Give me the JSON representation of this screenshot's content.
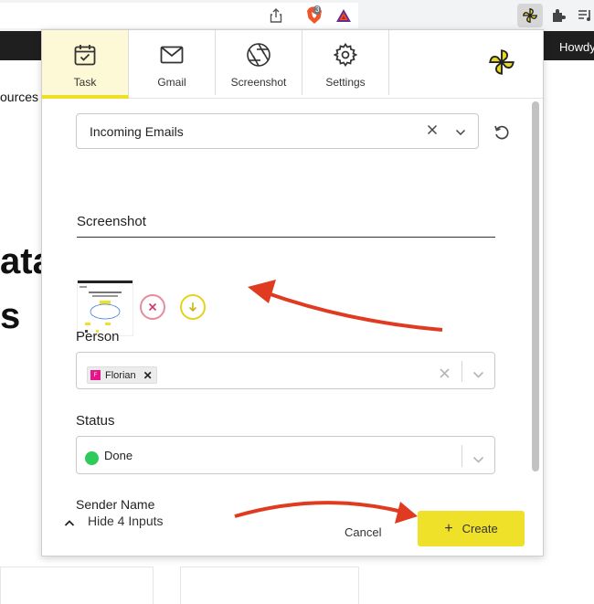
{
  "browser": {
    "brave_badge_count": "3",
    "icons": [
      "share-icon",
      "brave-shield-icon",
      "bat-rewards-icon",
      "extension-pinwheel-icon",
      "puzzle-extensions-icon",
      "media-queue-icon"
    ]
  },
  "background_page": {
    "greeting": "Howdy",
    "text_fragment_1": "ources",
    "text_fragment_2": "ata",
    "text_fragment_3": "s"
  },
  "popup": {
    "tabs": [
      {
        "label": "Task",
        "icon": "calendar-check-icon",
        "active": true
      },
      {
        "label": "Gmail",
        "icon": "mail-icon",
        "active": false
      },
      {
        "label": "Screenshot",
        "icon": "aperture-icon",
        "active": false
      },
      {
        "label": "Settings",
        "icon": "gear-icon",
        "active": false
      }
    ],
    "list_select": {
      "value": "Incoming Emails"
    },
    "screenshot": {
      "label": "Screenshot"
    },
    "person": {
      "label": "Person",
      "chip_initial": "F",
      "chip_name": "Florian",
      "chip_remove": "✕"
    },
    "status": {
      "label": "Status",
      "value": "Done"
    },
    "sender_name": {
      "label": "Sender Name"
    },
    "footer": {
      "toggle_label": "Hide 4 Inputs",
      "cancel_label": "Cancel",
      "create_plus": "+",
      "create_label": "Create"
    }
  },
  "colors": {
    "accent_yellow": "#efe02a",
    "active_tab_bg": "#fdf9d6",
    "delete_pink": "#e88aa0",
    "download_yellow": "#e6d21c",
    "status_green": "#2ecb5a",
    "chip_avatar": "#e6158b",
    "arrow_red": "#e03a21"
  }
}
